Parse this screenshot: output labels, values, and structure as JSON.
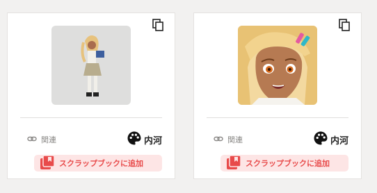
{
  "cards": [
    {
      "related_label": "関連",
      "artist": "内河",
      "scrap_label": "スクラップブックに追加",
      "icons": {
        "copy": "copy-icon",
        "related": "link-icon",
        "artist": "palette-icon",
        "scrap": "scrapbook-icon"
      }
    },
    {
      "related_label": "関連",
      "artist": "内河",
      "scrap_label": "スクラップブックに追加",
      "icons": {
        "copy": "copy-icon",
        "related": "link-icon",
        "artist": "palette-icon",
        "scrap": "scrapbook-icon"
      }
    }
  ],
  "colors": {
    "accent": "#e84b4b",
    "accent_bg": "#fde5e5",
    "page_bg": "#f2f1f0"
  }
}
